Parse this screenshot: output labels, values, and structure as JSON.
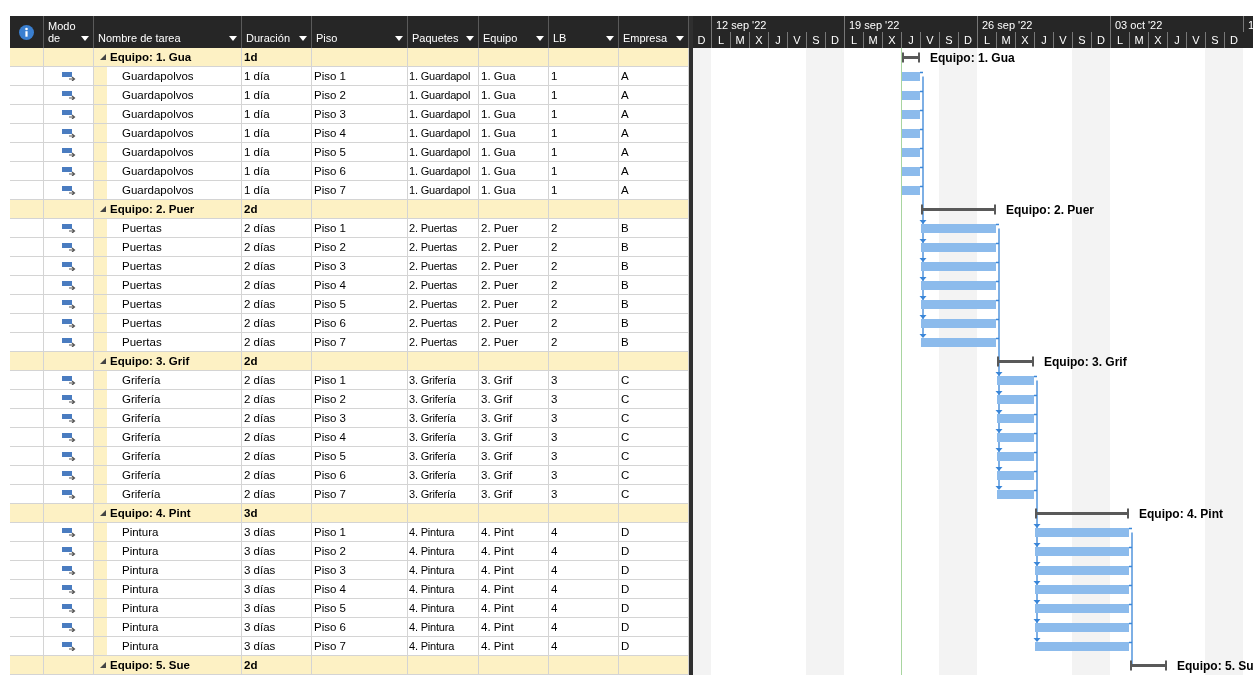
{
  "table": {
    "columns": [
      {
        "label": "Modo de"
      },
      {
        "label": "Nombre de tarea"
      },
      {
        "label": "Duración"
      },
      {
        "label": "Piso"
      },
      {
        "label": "Paquetes"
      },
      {
        "label": "Equipo"
      },
      {
        "label": "LB"
      },
      {
        "label": "Empresa"
      }
    ],
    "groups": [
      {
        "name": "Equipo: 1. Gua",
        "duration": "1d",
        "expanded": true,
        "bar_label": "Equipo: 1. Gua",
        "tasks": [
          {
            "name": "Guardapolvos",
            "duration": "1 día",
            "floor": "Piso 1",
            "package": "1. Guardapol",
            "team": "1. Gua",
            "lb": "1",
            "company": "A"
          },
          {
            "name": "Guardapolvos",
            "duration": "1 día",
            "floor": "Piso 2",
            "package": "1. Guardapol",
            "team": "1. Gua",
            "lb": "1",
            "company": "A"
          },
          {
            "name": "Guardapolvos",
            "duration": "1 día",
            "floor": "Piso 3",
            "package": "1. Guardapol",
            "team": "1. Gua",
            "lb": "1",
            "company": "A"
          },
          {
            "name": "Guardapolvos",
            "duration": "1 día",
            "floor": "Piso 4",
            "package": "1. Guardapol",
            "team": "1. Gua",
            "lb": "1",
            "company": "A"
          },
          {
            "name": "Guardapolvos",
            "duration": "1 día",
            "floor": "Piso 5",
            "package": "1. Guardapol",
            "team": "1. Gua",
            "lb": "1",
            "company": "A"
          },
          {
            "name": "Guardapolvos",
            "duration": "1 día",
            "floor": "Piso 6",
            "package": "1. Guardapol",
            "team": "1. Gua",
            "lb": "1",
            "company": "A"
          },
          {
            "name": "Guardapolvos",
            "duration": "1 día",
            "floor": "Piso 7",
            "package": "1. Guardapol",
            "team": "1. Gua",
            "lb": "1",
            "company": "A"
          }
        ]
      },
      {
        "name": "Equipo: 2. Puer",
        "duration": "2d",
        "expanded": true,
        "bar_label": "Equipo: 2. Puer",
        "tasks": [
          {
            "name": "Puertas",
            "duration": "2 días",
            "floor": "Piso 1",
            "package": "2. Puertas",
            "team": "2. Puer",
            "lb": "2",
            "company": "B"
          },
          {
            "name": "Puertas",
            "duration": "2 días",
            "floor": "Piso 2",
            "package": "2. Puertas",
            "team": "2. Puer",
            "lb": "2",
            "company": "B"
          },
          {
            "name": "Puertas",
            "duration": "2 días",
            "floor": "Piso 3",
            "package": "2. Puertas",
            "team": "2. Puer",
            "lb": "2",
            "company": "B"
          },
          {
            "name": "Puertas",
            "duration": "2 días",
            "floor": "Piso 4",
            "package": "2. Puertas",
            "team": "2. Puer",
            "lb": "2",
            "company": "B"
          },
          {
            "name": "Puertas",
            "duration": "2 días",
            "floor": "Piso 5",
            "package": "2. Puertas",
            "team": "2. Puer",
            "lb": "2",
            "company": "B"
          },
          {
            "name": "Puertas",
            "duration": "2 días",
            "floor": "Piso 6",
            "package": "2. Puertas",
            "team": "2. Puer",
            "lb": "2",
            "company": "B"
          },
          {
            "name": "Puertas",
            "duration": "2 días",
            "floor": "Piso 7",
            "package": "2. Puertas",
            "team": "2. Puer",
            "lb": "2",
            "company": "B"
          }
        ]
      },
      {
        "name": "Equipo: 3. Grif",
        "duration": "2d",
        "expanded": true,
        "bar_label": "Equipo: 3. Grif",
        "tasks": [
          {
            "name": "Grifería",
            "duration": "2 días",
            "floor": "Piso 1",
            "package": "3. Grifería",
            "team": "3. Grif",
            "lb": "3",
            "company": "C"
          },
          {
            "name": "Grifería",
            "duration": "2 días",
            "floor": "Piso 2",
            "package": "3. Grifería",
            "team": "3. Grif",
            "lb": "3",
            "company": "C"
          },
          {
            "name": "Grifería",
            "duration": "2 días",
            "floor": "Piso 3",
            "package": "3. Grifería",
            "team": "3. Grif",
            "lb": "3",
            "company": "C"
          },
          {
            "name": "Grifería",
            "duration": "2 días",
            "floor": "Piso 4",
            "package": "3. Grifería",
            "team": "3. Grif",
            "lb": "3",
            "company": "C"
          },
          {
            "name": "Grifería",
            "duration": "2 días",
            "floor": "Piso 5",
            "package": "3. Grifería",
            "team": "3. Grif",
            "lb": "3",
            "company": "C"
          },
          {
            "name": "Grifería",
            "duration": "2 días",
            "floor": "Piso 6",
            "package": "3. Grifería",
            "team": "3. Grif",
            "lb": "3",
            "company": "C"
          },
          {
            "name": "Grifería",
            "duration": "2 días",
            "floor": "Piso 7",
            "package": "3. Grifería",
            "team": "3. Grif",
            "lb": "3",
            "company": "C"
          }
        ]
      },
      {
        "name": "Equipo: 4. Pint",
        "duration": "3d",
        "expanded": true,
        "bar_label": "Equipo: 4. Pint",
        "tasks": [
          {
            "name": "Pintura",
            "duration": "3 días",
            "floor": "Piso 1",
            "package": "4. Pintura",
            "team": "4. Pint",
            "lb": "4",
            "company": "D"
          },
          {
            "name": "Pintura",
            "duration": "3 días",
            "floor": "Piso 2",
            "package": "4. Pintura",
            "team": "4. Pint",
            "lb": "4",
            "company": "D"
          },
          {
            "name": "Pintura",
            "duration": "3 días",
            "floor": "Piso 3",
            "package": "4. Pintura",
            "team": "4. Pint",
            "lb": "4",
            "company": "D"
          },
          {
            "name": "Pintura",
            "duration": "3 días",
            "floor": "Piso 4",
            "package": "4. Pintura",
            "team": "4. Pint",
            "lb": "4",
            "company": "D"
          },
          {
            "name": "Pintura",
            "duration": "3 días",
            "floor": "Piso 5",
            "package": "4. Pintura",
            "team": "4. Pint",
            "lb": "4",
            "company": "D"
          },
          {
            "name": "Pintura",
            "duration": "3 días",
            "floor": "Piso 6",
            "package": "4. Pintura",
            "team": "4. Pint",
            "lb": "4",
            "company": "D"
          },
          {
            "name": "Pintura",
            "duration": "3 días",
            "floor": "Piso 7",
            "package": "4. Pintura",
            "team": "4. Pint",
            "lb": "4",
            "company": "D"
          }
        ]
      },
      {
        "name": "Equipo: 5. Sue",
        "duration": "2d",
        "expanded": true,
        "bar_label": "Equipo: 5. Su"
      }
    ]
  },
  "timescale": {
    "weeks": [
      {
        "label": "12 sep '22"
      },
      {
        "label": "19 sep '22"
      },
      {
        "label": "26 sep '22"
      },
      {
        "label": "03 oct '22"
      },
      {
        "label": "1"
      }
    ],
    "days": [
      {
        "label": "D",
        "nonworking": true
      },
      {
        "label": "L",
        "nonworking": false
      },
      {
        "label": "M",
        "nonworking": false
      },
      {
        "label": "X",
        "nonworking": false
      },
      {
        "label": "J",
        "nonworking": false
      },
      {
        "label": "V",
        "nonworking": false
      },
      {
        "label": "S",
        "nonworking": true
      },
      {
        "label": "D",
        "nonworking": true
      },
      {
        "label": "L",
        "nonworking": false
      },
      {
        "label": "M",
        "nonworking": false
      },
      {
        "label": "X",
        "nonworking": false
      },
      {
        "label": "J",
        "nonworking": false
      },
      {
        "label": "V",
        "nonworking": false
      },
      {
        "label": "S",
        "nonworking": true
      },
      {
        "label": "D",
        "nonworking": true
      },
      {
        "label": "L",
        "nonworking": false
      },
      {
        "label": "M",
        "nonworking": false
      },
      {
        "label": "X",
        "nonworking": false
      },
      {
        "label": "J",
        "nonworking": false
      },
      {
        "label": "V",
        "nonworking": false
      },
      {
        "label": "S",
        "nonworking": true
      },
      {
        "label": "D",
        "nonworking": true
      },
      {
        "label": "L",
        "nonworking": false
      },
      {
        "label": "M",
        "nonworking": false
      },
      {
        "label": "X",
        "nonworking": false
      },
      {
        "label": "J",
        "nonworking": false
      },
      {
        "label": "V",
        "nonworking": false
      },
      {
        "label": "S",
        "nonworking": true
      },
      {
        "label": "D",
        "nonworking": true
      }
    ]
  }
}
